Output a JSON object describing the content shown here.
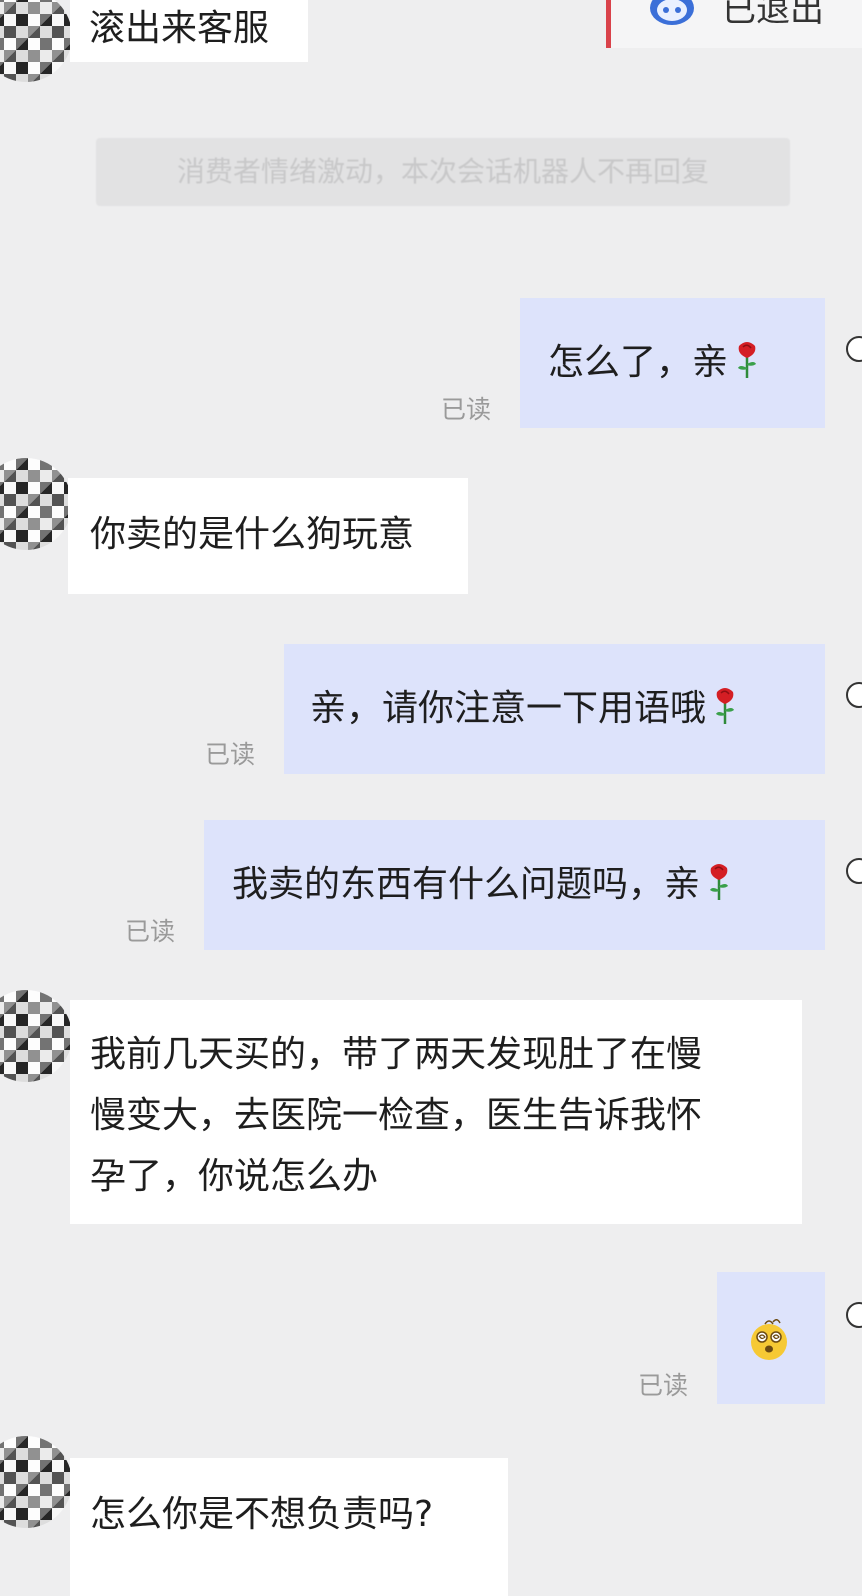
{
  "header": {
    "exit_notice": "已退出"
  },
  "system_message": "消费者情绪激动，本次会话机器人不再回复",
  "messages": [
    {
      "side": "in",
      "text": "滚出来客服"
    },
    {
      "side": "out",
      "text": "怎么了，亲",
      "emoji": "rose-icon",
      "status": "已读"
    },
    {
      "side": "in",
      "text": "你卖的是什么狗玩意"
    },
    {
      "side": "out",
      "text": "亲，请你注意一下用语哦",
      "emoji": "rose-icon",
      "status": "已读"
    },
    {
      "side": "out",
      "text": "我卖的东西有什么问题吗，亲",
      "emoji": "rose-icon",
      "status": "已读"
    },
    {
      "side": "in",
      "lines": [
        "我前几天买的，带了两天发现肚了在慢",
        "慢变大，去医院一检查，医生告诉我怀",
        "孕了，你说怎么办"
      ]
    },
    {
      "side": "out",
      "emoji": "dizzy-face-icon",
      "status": "已读"
    },
    {
      "side": "in",
      "text": "怎么你是不想负责吗?"
    }
  ],
  "colors": {
    "background": "#eeeeef",
    "incoming_bubble": "#ffffff",
    "outgoing_bubble": "#dde3fb",
    "read_status": "#9a9a9a",
    "accent_red": "#d9424a"
  }
}
